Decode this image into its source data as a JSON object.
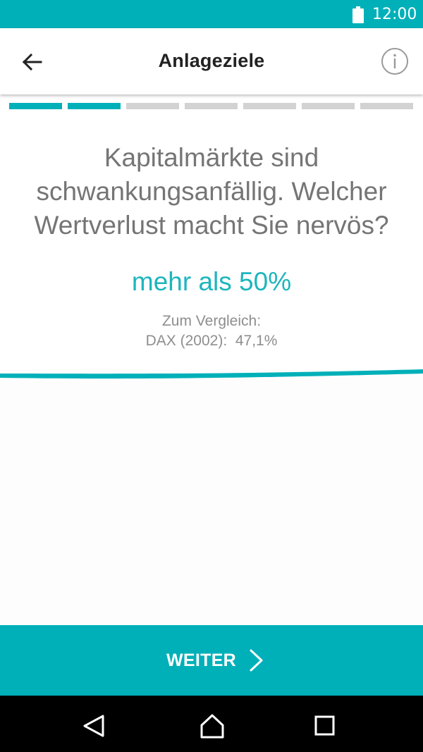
{
  "status_bar": {
    "time": "12:00"
  },
  "app_bar": {
    "title": "Anlageziele"
  },
  "progress": {
    "total_steps": 7,
    "completed_steps": 2
  },
  "question": {
    "text": "Kapitalmärkte sind schwankungsanfällig. Welcher Wertverlust macht Sie nervös?",
    "answer_value": "mehr als 50%",
    "comparison_label": "Zum Vergleich:",
    "comparison_value": "DAX (2002):  47,1%"
  },
  "next_button": {
    "label": "WEITER"
  },
  "colors": {
    "accent": "#00b0b9",
    "text_gray": "#757575",
    "inactive_progress": "#d2d2d2"
  },
  "icons": [
    "battery-icon",
    "back-arrow-icon",
    "info-icon",
    "chevron-right-icon",
    "nav-back-icon",
    "nav-home-icon",
    "nav-recents-icon"
  ]
}
